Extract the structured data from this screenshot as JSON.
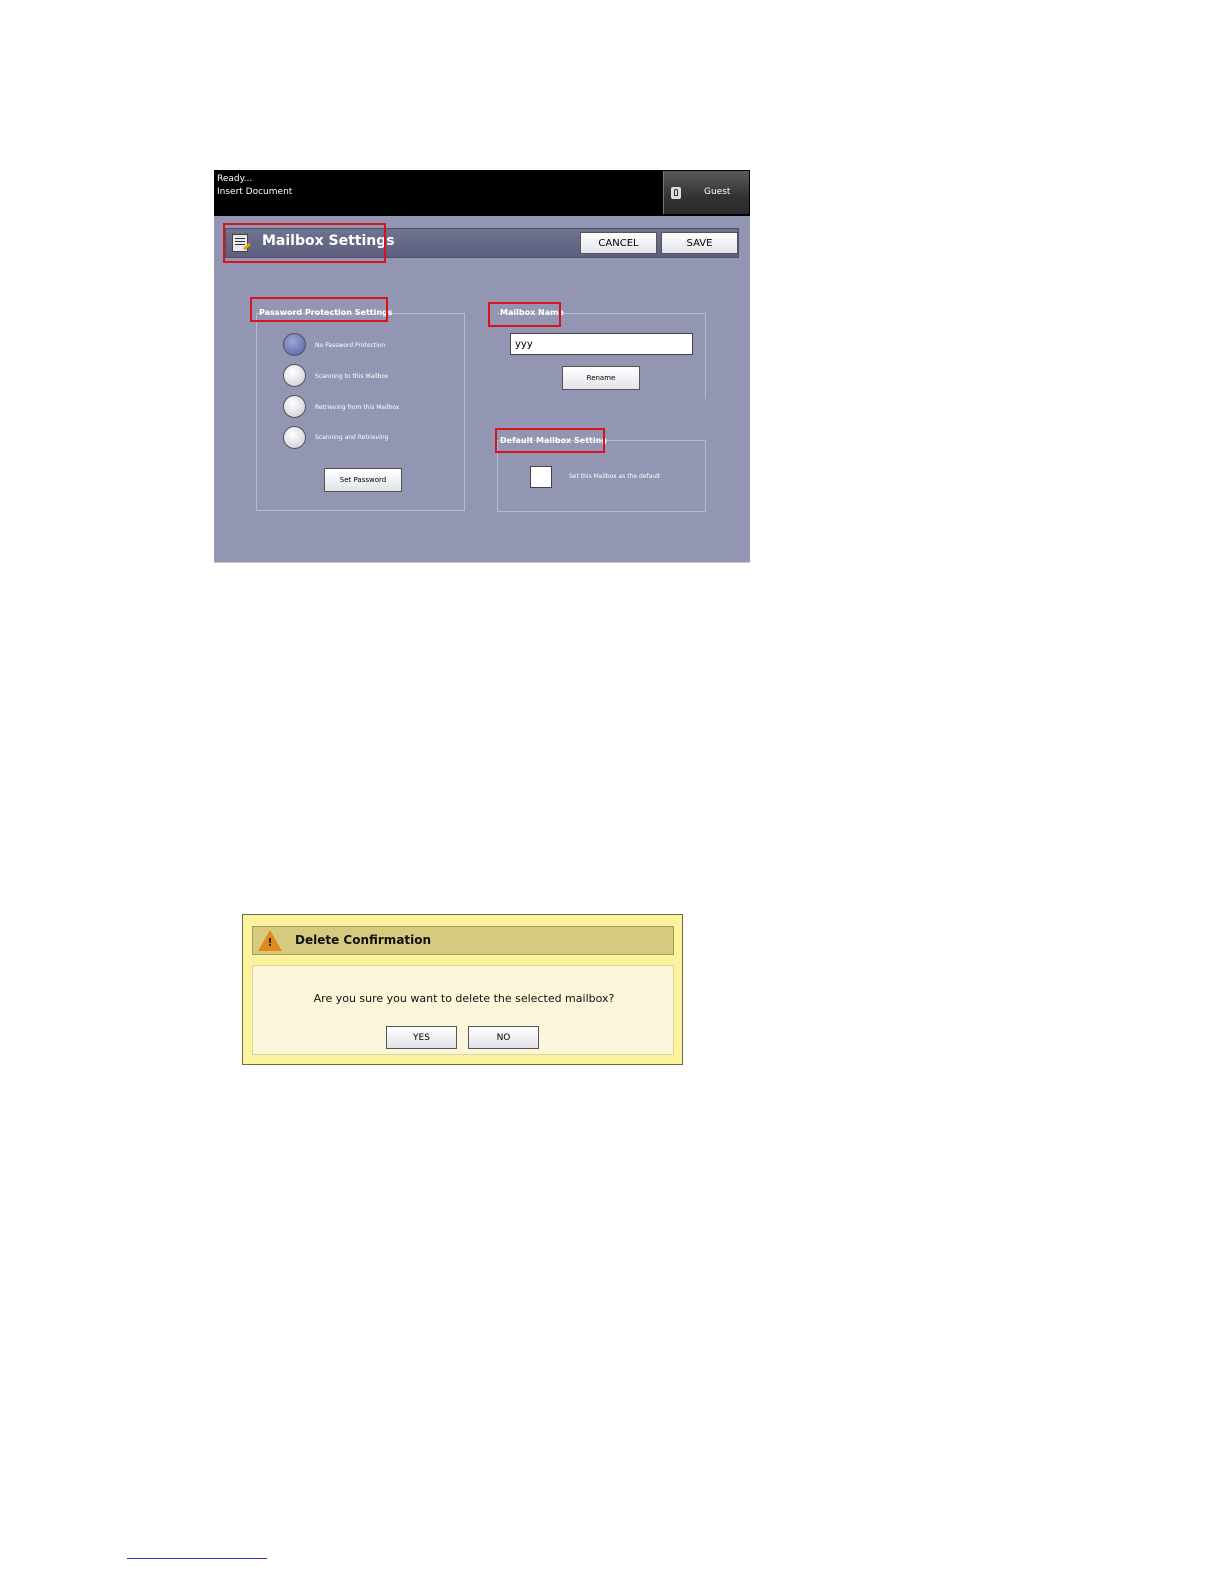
{
  "statusbar": {
    "line1": "Ready...",
    "line2": "Insert Document",
    "user_label": "Guest",
    "user_icon": "lock-icon"
  },
  "header": {
    "title": "Mailbox Settings",
    "icon": "document-edit-icon",
    "cancel_label": "CANCEL",
    "save_label": "SAVE"
  },
  "password_group": {
    "title": "Password Protection Settings",
    "options": [
      {
        "label": "No Password Protection",
        "selected": true
      },
      {
        "label": "Scanning to this Mailbox",
        "selected": false
      },
      {
        "label": "Retrieving from this Mailbox",
        "selected": false
      },
      {
        "label": "Scanning and Retrieving",
        "selected": false
      }
    ],
    "set_password_label": "Set Password"
  },
  "name_group": {
    "title": "Mailbox Name",
    "value": "yyy",
    "rename_label": "Rename"
  },
  "default_group": {
    "title": "Default Mailbox Setting",
    "checkbox_label": "Set this Mailbox as the default",
    "checked": false
  },
  "highlight_color": "#d9131a",
  "dialog": {
    "title": "Delete Confirmation",
    "icon": "warning-icon",
    "message": "Are you sure you want to delete the selected mailbox?",
    "yes_label": "YES",
    "no_label": "NO"
  }
}
